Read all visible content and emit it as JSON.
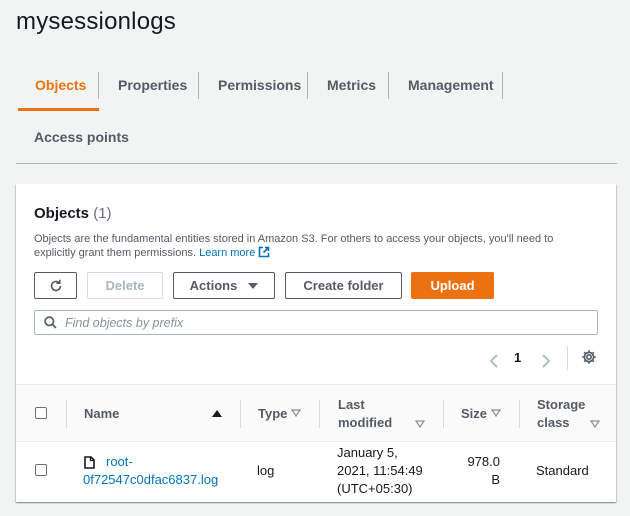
{
  "page": {
    "title": "mysessionlogs"
  },
  "tabs": [
    {
      "label": "Objects",
      "active": true
    },
    {
      "label": "Properties"
    },
    {
      "label": "Permissions"
    },
    {
      "label": "Metrics"
    },
    {
      "label": "Management"
    },
    {
      "label": "Access points"
    }
  ],
  "panel": {
    "title": "Objects",
    "count": "(1)",
    "description": "Objects are the fundamental entities stored in Amazon S3. For others to access your objects, you'll need to explicitly grant them permissions.",
    "learn_more": "Learn more"
  },
  "toolbar": {
    "refresh_icon": "refresh-icon",
    "delete_label": "Delete",
    "actions_label": "Actions",
    "create_folder_label": "Create folder",
    "upload_label": "Upload"
  },
  "search": {
    "placeholder": "Find objects by prefix",
    "value": ""
  },
  "pagination": {
    "current_page": "1"
  },
  "table": {
    "columns": {
      "name": "Name",
      "type": "Type",
      "last_modified_1": "Last",
      "last_modified_2": "modified",
      "size": "Size",
      "storage_class_1": "Storage",
      "storage_class_2": "class"
    },
    "rows": [
      {
        "name_1": "root-",
        "name_2": "0f72547c0dfac6837.log",
        "type": "log",
        "last_modified_1": "January 5,",
        "last_modified_2": "2021, 11:54:49",
        "last_modified_3": "(UTC+05:30)",
        "size_1": "978.0",
        "size_2": "B",
        "storage_class": "Standard"
      }
    ]
  },
  "colors": {
    "accent": "#ec7211",
    "link": "#0073bb",
    "text": "#16191f",
    "muted": "#545b64",
    "background": "#f2f3f3"
  }
}
